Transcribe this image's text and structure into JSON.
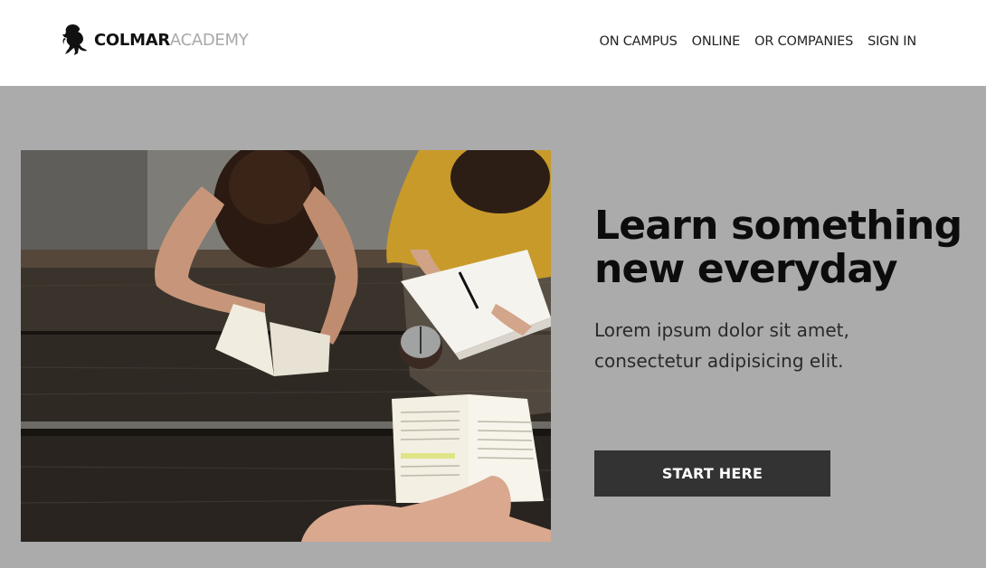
{
  "brand": {
    "name_strong": "COLMAR",
    "name_light": "ACADEMY",
    "logo_icon": "lion-rampant-icon"
  },
  "nav": {
    "items": [
      {
        "label": "ON CAMPUS"
      },
      {
        "label": "ONLINE"
      },
      {
        "label": "OR COMPANIES"
      },
      {
        "label": "SIGN IN"
      }
    ]
  },
  "hero": {
    "image_desc": "photo of students reading books at a wooden picnic table",
    "headline": "Learn something new everyday",
    "subtext": "Lorem ipsum dolor sit amet, consectetur adipisicing elit.",
    "cta_label": "START HERE"
  },
  "colors": {
    "header_bg": "#ffffff",
    "hero_bg": "#ababab",
    "button_bg": "#333333",
    "logo_light": "#a9a9a9"
  }
}
